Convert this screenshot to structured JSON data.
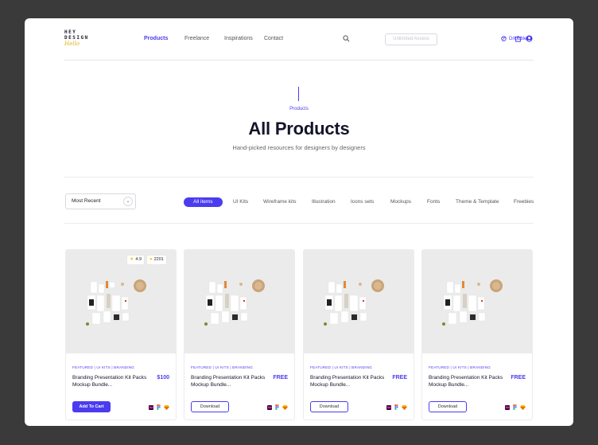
{
  "logo": {
    "line1": "HEY",
    "line2": "DESIGN",
    "line3": "Hello"
  },
  "nav": {
    "products": "Products",
    "freelance": "Freelance",
    "inspirations": "Inspirations",
    "contact": "Contact"
  },
  "header": {
    "unlimited_access": "Unlimited Access",
    "dribbble": "Dribbble"
  },
  "hero": {
    "eyebrow": "Products",
    "title": "All Products",
    "subtitle": "Hand-picked resources for designers by designers"
  },
  "filters": {
    "sort_value": "Most Recent",
    "chips": [
      "All items",
      "UI Kits",
      "Wireframe kits",
      "Illustration",
      "Icons sets",
      "Mockups",
      "Fonts",
      "Theme & Template",
      "Freebies"
    ]
  },
  "colors": {
    "accent": "#4b3cf0",
    "rating_star": "#f5c518"
  },
  "cards": [
    {
      "tags": "FEATURED | UI KITS | BRANDING",
      "title": "Branding Presentation Kit Packs Mockup Bundle...",
      "price": "$100",
      "button": "Add To Cart",
      "rating": "4.9",
      "downloads": "2201"
    },
    {
      "tags": "FEATURED | UI KITS | BRANDING",
      "title": "Branding Presentation Kit Packs Mockup Bundle...",
      "price": "FREE",
      "button": "Download"
    },
    {
      "tags": "FEATURED | UI KITS | BRANDING",
      "title": "Branding Presentation Kit Packs Mockup Bundle...",
      "price": "FREE",
      "button": "Download"
    },
    {
      "tags": "FEATURED | UI KITS | BRANDING",
      "title": "Branding Presentation Kit Packs Mockup Bundle...",
      "price": "FREE",
      "button": "Download"
    }
  ]
}
